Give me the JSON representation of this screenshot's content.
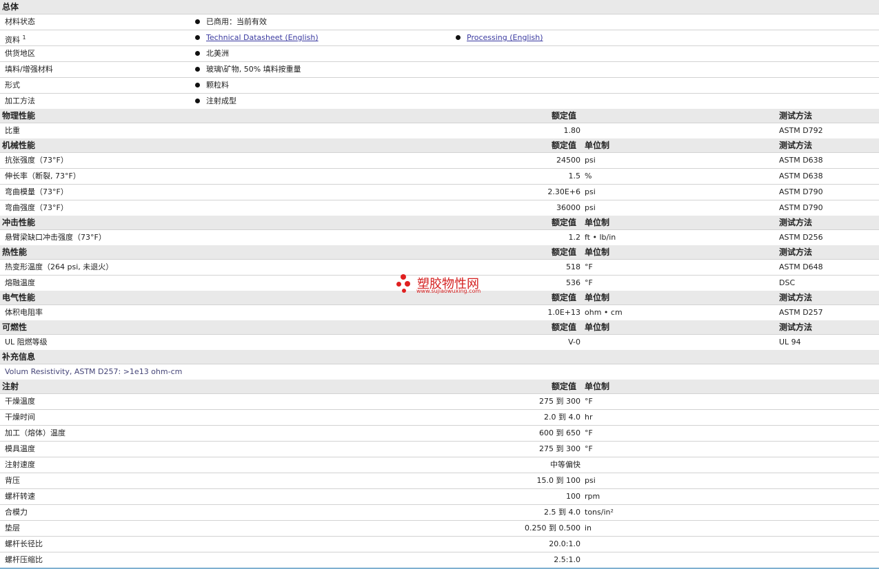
{
  "general": {
    "title": "总体",
    "rows": [
      {
        "label": "材料状态",
        "value": "已商用：当前有效"
      },
      {
        "label": "资料",
        "sup": "1",
        "link1": "Technical Datasheet (English)",
        "link2": "Processing (English)"
      },
      {
        "label": "供货地区",
        "value": "北美洲"
      },
      {
        "label": "填料/增强材料",
        "value": "玻璃\\矿物, 50% 填料按重量"
      },
      {
        "label": "形式",
        "value": "颗粒料"
      },
      {
        "label": "加工方法",
        "value": "注射成型"
      }
    ]
  },
  "col_headers": {
    "nominal": "额定值",
    "unit": "单位制",
    "test": "测试方法"
  },
  "physical": {
    "title": "物理性能",
    "rows": [
      {
        "label": "比重",
        "value": "1.80",
        "unit": "",
        "test": "ASTM D792"
      }
    ]
  },
  "mechanical": {
    "title": "机械性能",
    "rows": [
      {
        "label": "抗张强度（73°F）",
        "value": "24500",
        "unit": "psi",
        "test": "ASTM D638"
      },
      {
        "label": "伸长率（断裂, 73°F）",
        "value": "1.5",
        "unit": "%",
        "test": "ASTM D638"
      },
      {
        "label": "弯曲模量（73°F）",
        "value": "2.30E+6",
        "unit": "psi",
        "test": "ASTM D790"
      },
      {
        "label": "弯曲强度（73°F）",
        "value": "36000",
        "unit": "psi",
        "test": "ASTM D790"
      }
    ]
  },
  "impact": {
    "title": "冲击性能",
    "rows": [
      {
        "label": "悬臂梁缺口冲击强度（73°F）",
        "value": "1.2",
        "unit": "ft • lb/in",
        "test": "ASTM D256"
      }
    ]
  },
  "thermal": {
    "title": "热性能",
    "rows": [
      {
        "label": "热变形温度（264 psi, 未退火）",
        "value": "518",
        "unit": "°F",
        "test": "ASTM D648"
      },
      {
        "label": "熔融温度",
        "value": "536",
        "unit": "°F",
        "test": "DSC"
      }
    ]
  },
  "electrical": {
    "title": "电气性能",
    "rows": [
      {
        "label": "体积电阻率",
        "value": "1.0E+13",
        "unit": "ohm • cm",
        "test": "ASTM D257"
      }
    ]
  },
  "flammability": {
    "title": "可燃性",
    "rows": [
      {
        "label": "UL 阻燃等级",
        "value": "V-0",
        "unit": "",
        "test": "UL 94"
      }
    ]
  },
  "supplement": {
    "title": "补充信息",
    "note": "Volum Resistivity, ASTM D257: >1e13 ohm-cm"
  },
  "injection": {
    "title": "注射",
    "rows": [
      {
        "label": "干燥温度",
        "value": "275 到 300",
        "unit": "°F"
      },
      {
        "label": "干燥时间",
        "value": "2.0 到 4.0",
        "unit": "hr"
      },
      {
        "label": "加工（熔体）温度",
        "value": "600 到 650",
        "unit": "°F"
      },
      {
        "label": "模具温度",
        "value": "275 到 300",
        "unit": "°F"
      },
      {
        "label": "注射速度",
        "value": "中等偏快",
        "unit": ""
      },
      {
        "label": "背压",
        "value": "15.0 到 100",
        "unit": "psi"
      },
      {
        "label": "螺杆转速",
        "value": "100",
        "unit": "rpm"
      },
      {
        "label": "合模力",
        "value": "2.5 到 4.0",
        "unit": "tons/in²"
      },
      {
        "label": "垫层",
        "value": "0.250 到 0.500",
        "unit": "in"
      },
      {
        "label": "螺杆长径比",
        "value": "20.0:1.0",
        "unit": ""
      },
      {
        "label": "螺杆压缩比",
        "value": "2.5:1.0",
        "unit": ""
      }
    ]
  },
  "watermark": {
    "name": "塑胶物性网",
    "url": "www.sujiaowuxing.com",
    "color": "#d42020"
  }
}
